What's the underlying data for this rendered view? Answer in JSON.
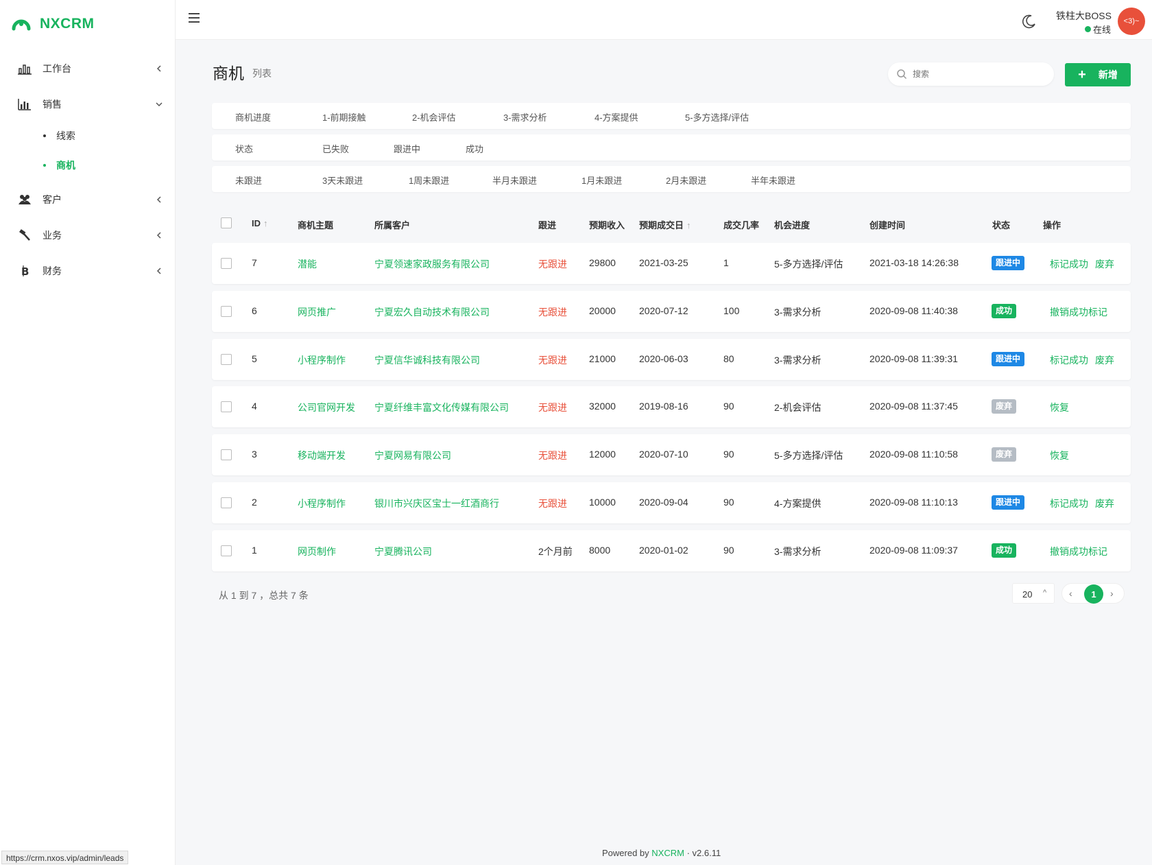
{
  "app": {
    "name": "NXCRM",
    "url": "https://crm.nxos.vip/admin/leads"
  },
  "sidebar": {
    "items": [
      {
        "label": "工作台",
        "icon": "bar-chart-icon"
      },
      {
        "label": "销售",
        "icon": "stats-icon"
      },
      {
        "label": "客户",
        "icon": "users-icon"
      },
      {
        "label": "业务",
        "icon": "hammer-icon"
      },
      {
        "label": "财务",
        "icon": "bitcoin-icon"
      }
    ],
    "sub_items": [
      {
        "label": "线索"
      },
      {
        "label": "商机"
      }
    ]
  },
  "header": {
    "user_name": "铁柱大BOSS",
    "user_status": "在线",
    "avatar_text": "<3)~"
  },
  "page": {
    "title": "商机",
    "subtitle": "列表",
    "search_placeholder": "搜索",
    "add_label": "新增"
  },
  "filters": {
    "progress": {
      "label": "商机进度",
      "options": [
        "1-前期接触",
        "2-机会评估",
        "3-需求分析",
        "4-方案提供",
        "5-多方选择/评估"
      ]
    },
    "status": {
      "label": "状态",
      "options": [
        "已失败",
        "跟进中",
        "成功"
      ]
    },
    "followup": {
      "label": "未跟进",
      "options": [
        "3天未跟进",
        "1周未跟进",
        "半月未跟进",
        "1月未跟进",
        "2月未跟进",
        "半年未跟进"
      ]
    }
  },
  "table": {
    "headers": {
      "id": "ID",
      "subject": "商机主题",
      "customer": "所属客户",
      "follow": "跟进",
      "revenue": "预期收入",
      "close_date": "预期成交日",
      "rate": "成交几率",
      "stage": "机会进度",
      "created": "创建时间",
      "status": "状态",
      "actions": "操作"
    },
    "rows": [
      {
        "id": "7",
        "subject": "潜能",
        "customer": "宁夏领速家政服务有限公司",
        "follow": "无跟进",
        "revenue": "29800",
        "close_date": "2021-03-25",
        "rate": "1",
        "stage": "5-多方选择/评估",
        "created": "2021-03-18 14:26:38",
        "status": "跟进中",
        "actions": [
          "标记成功",
          "废弃"
        ]
      },
      {
        "id": "6",
        "subject": "网页推广",
        "customer": "宁夏宏久自动技术有限公司",
        "follow": "无跟进",
        "revenue": "20000",
        "close_date": "2020-07-12",
        "rate": "100",
        "stage": "3-需求分析",
        "created": "2020-09-08 11:40:38",
        "status": "成功",
        "actions": [
          "撤销成功标记"
        ]
      },
      {
        "id": "5",
        "subject": "小程序制作",
        "customer": "宁夏信华诚科技有限公司",
        "follow": "无跟进",
        "revenue": "21000",
        "close_date": "2020-06-03",
        "rate": "80",
        "stage": "3-需求分析",
        "created": "2020-09-08 11:39:31",
        "status": "跟进中",
        "actions": [
          "标记成功",
          "废弃"
        ]
      },
      {
        "id": "4",
        "subject": "公司官网开发",
        "customer": "宁夏纤维丰富文化传媒有限公司",
        "follow": "无跟进",
        "revenue": "32000",
        "close_date": "2019-08-16",
        "rate": "90",
        "stage": "2-机会评估",
        "created": "2020-09-08 11:37:45",
        "status": "废弃",
        "actions": [
          "恢复"
        ]
      },
      {
        "id": "3",
        "subject": "移动端开发",
        "customer": "宁夏网易有限公司",
        "follow": "无跟进",
        "revenue": "12000",
        "close_date": "2020-07-10",
        "rate": "90",
        "stage": "5-多方选择/评估",
        "created": "2020-09-08 11:10:58",
        "status": "废弃",
        "actions": [
          "恢复"
        ]
      },
      {
        "id": "2",
        "subject": "小程序制作",
        "customer": "银川市兴庆区宝士一红酒商行",
        "follow": "无跟进",
        "revenue": "10000",
        "close_date": "2020-09-04",
        "rate": "90",
        "stage": "4-方案提供",
        "created": "2020-09-08 11:10:13",
        "status": "跟进中",
        "actions": [
          "标记成功",
          "废弃"
        ]
      },
      {
        "id": "1",
        "subject": "网页制作",
        "customer": "宁夏腾讯公司",
        "follow": "2个月前",
        "revenue": "8000",
        "close_date": "2020-01-02",
        "rate": "90",
        "stage": "3-需求分析",
        "created": "2020-09-08 11:09:37",
        "status": "成功",
        "actions": [
          "撤销成功标记"
        ]
      }
    ]
  },
  "pagination": {
    "info": "从 1 到 7 ，总共 7 条",
    "page_size": "20",
    "current": "1"
  },
  "footer": {
    "prefix": "Powered by",
    "brand": "NXCRM",
    "sep": "·",
    "version": "v2.6.11"
  },
  "colors": {
    "brand": "#18b35e",
    "danger": "#e8503a",
    "info": "#1e88e5",
    "muted": "#b5bcc4"
  }
}
